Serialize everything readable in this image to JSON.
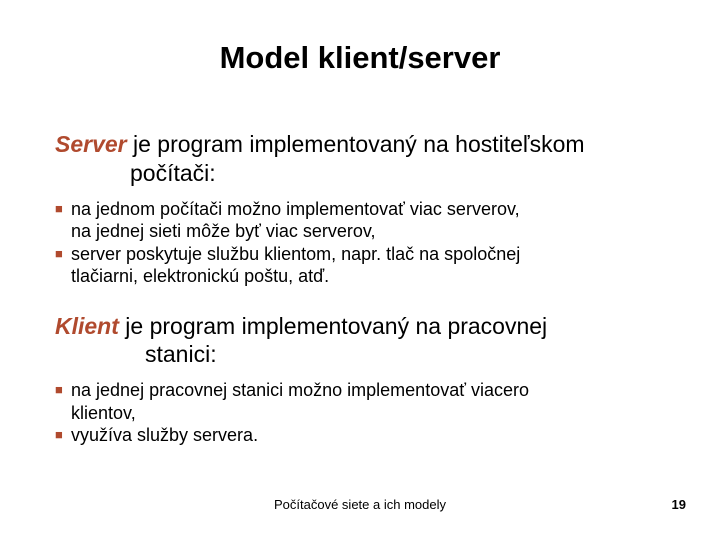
{
  "title": "Model klient/server",
  "server": {
    "term": "Server",
    "lead_after": " je program implementovaný na hostiteľskom",
    "lead_cont": "počítači:",
    "b1a": "na jednom počítači možno implementovať viac serverov,",
    "b1b": "na jednej sieti môže byť viac serverov,",
    "b2a": "server poskytuje službu klientom, napr. tlač na spoločnej",
    "b2b": "tlačiarni, elektronickú poštu, atď."
  },
  "klient": {
    "term": "Klient",
    "lead_after": " je program implementovaný na pracovnej",
    "lead_cont": "stanici:",
    "b1a": "na jednej pracovnej stanici možno implementovať viacero",
    "b1b": "klientov,",
    "b2a": "využíva služby servera."
  },
  "footer_center": "Počítačové siete a ich modely",
  "page_number": "19"
}
